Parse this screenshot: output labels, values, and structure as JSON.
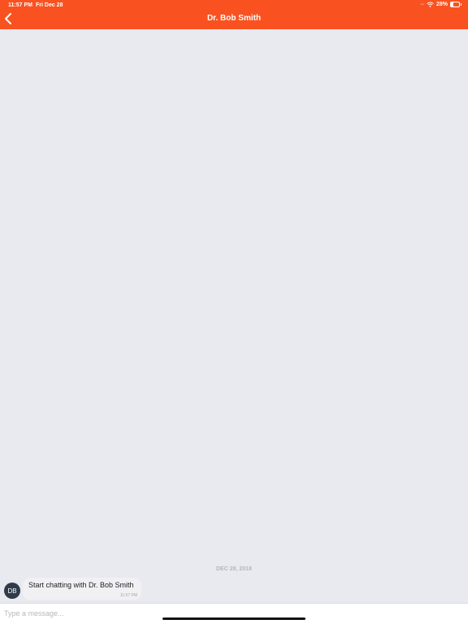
{
  "status_bar": {
    "time": "11:57 PM",
    "date": "Fri Dec 28",
    "battery_percent": "28%",
    "battery_level": 0.28,
    "icons": [
      "signal-dots-icon",
      "wifi-icon",
      "battery-icon"
    ]
  },
  "header": {
    "title": "Dr. Bob Smith",
    "back_icon": "chevron-left-icon",
    "background_color": "#f95220"
  },
  "conversation": {
    "date_separator": "DEC 28, 2018",
    "messages": [
      {
        "avatar_initials": "DB",
        "text": "Start chatting with Dr. Bob Smith",
        "time": "11:57 PM"
      }
    ]
  },
  "composer": {
    "placeholder": "Type a message..."
  }
}
